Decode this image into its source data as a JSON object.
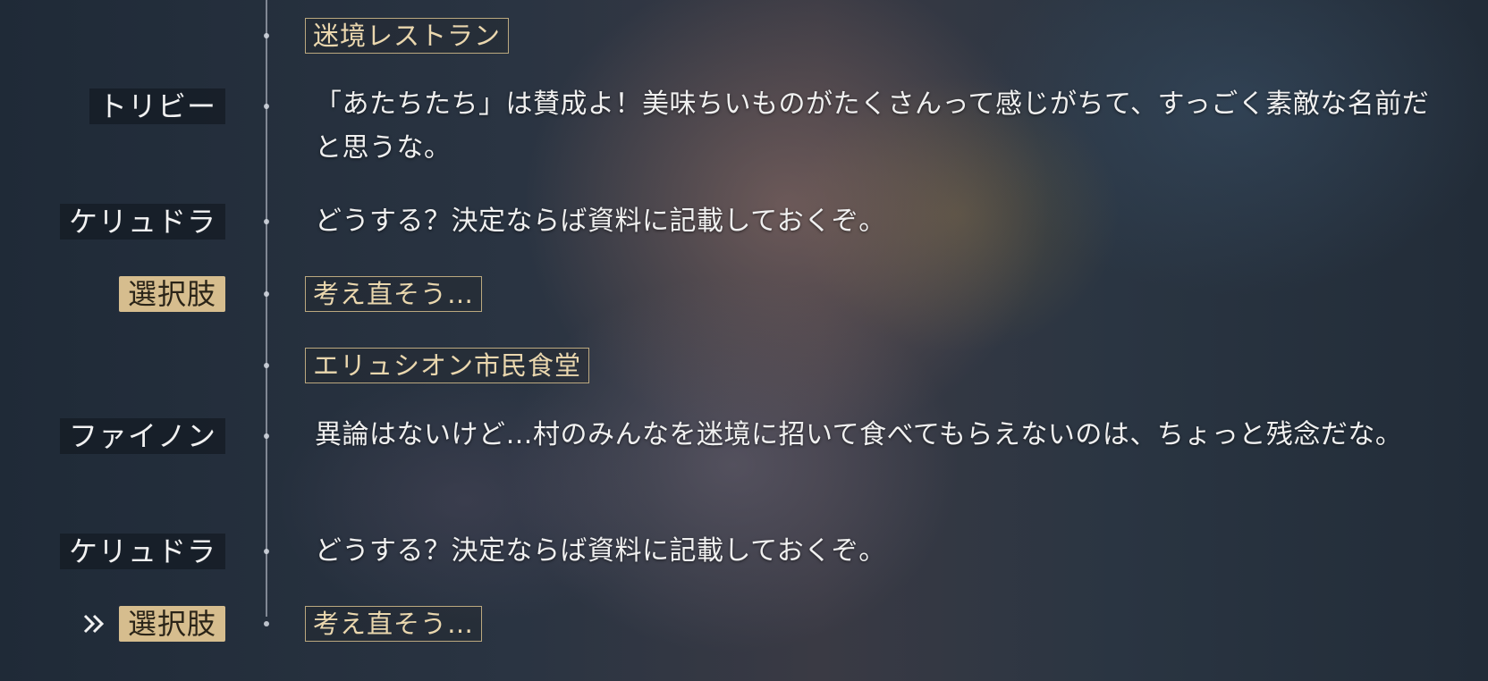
{
  "log": [
    {
      "type": "location",
      "text": "迷境レストラン"
    },
    {
      "type": "dialogue",
      "speaker": "トリビー",
      "text": "「あたちたち」は賛成よ！美味ちいものがたくさんって感じがちて、すっごく素敵な名前だと思うな。"
    },
    {
      "type": "dialogue",
      "speaker": "ケリュドラ",
      "text": "どうする？決定ならば資料に記載しておくぞ。"
    },
    {
      "type": "choice",
      "tag": "選択肢",
      "text": "考え直そう…"
    },
    {
      "type": "location",
      "text": "エリュシオン市民食堂"
    },
    {
      "type": "dialogue",
      "speaker": "ファイノン",
      "text": "異論はないけど…村のみんなを迷境に招いて食べてもらえないのは、ちょっと残念だな。"
    },
    {
      "type": "dialogue",
      "speaker": "ケリュドラ",
      "text": "どうする？決定ならば資料に記載しておくぞ。"
    },
    {
      "type": "choice",
      "tag": "選択肢",
      "text": "考え直そう…",
      "current": true
    }
  ],
  "icons": {
    "current_marker": "double-chevron-right-icon"
  },
  "colors": {
    "choice_tag_bg": "#d6bd8e",
    "place_tag_border": "#d6be8c",
    "text": "#f0f0f0"
  }
}
